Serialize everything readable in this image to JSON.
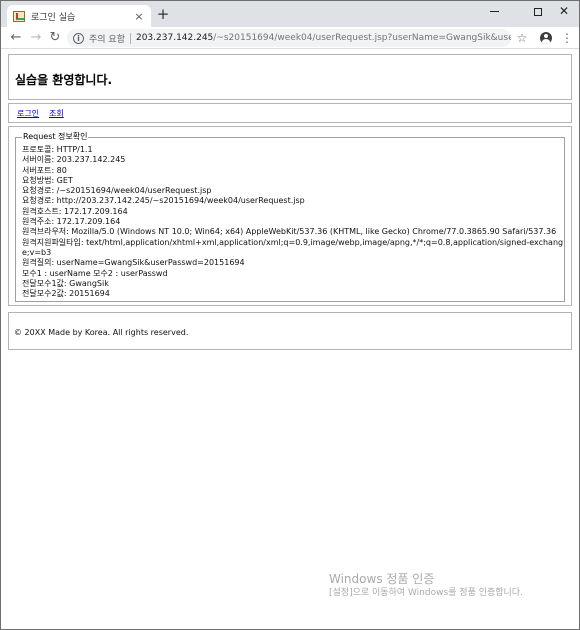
{
  "browser": {
    "tab_title": "로그인 실습",
    "tab_close": "×",
    "new_tab": "+",
    "security_label": "주의 요함",
    "url_host": "203.237.142.245",
    "url_rest": "/~s20151694/week04/userRequest.jsp?userName=GwangSik&userPasswd=2015..."
  },
  "page": {
    "title": "실습을 환영합니다.",
    "nav": [
      "로그인",
      "조회"
    ],
    "legend": "Request 정보확인",
    "info_lines": [
      "프로토콜: HTTP/1.1",
      "서버이름: 203.237.142.245",
      "서버포트: 80",
      "요청방법: GET",
      "요청경로: /~s20151694/week04/userRequest.jsp",
      "요청경로: http://203.237.142.245/~s20151694/week04/userRequest.jsp",
      "원격호스트: 172.17.209.164",
      "원격주소: 172.17.209.164",
      "원격브라우저: Mozilla/5.0 (Windows NT 10.0; Win64; x64) AppleWebKit/537.36 (KHTML, like Gecko) Chrome/77.0.3865.90 Safari/537.36",
      "원격지원파일타입: text/html,application/xhtml+xml,application/xml;q=0.9,image/webp,image/apng,*/*;q=0.8,application/signed-exchange;v=b3",
      "원격질의: userName=GwangSik&userPasswd=20151694",
      "모수1 : userName 모수2 : userPasswd",
      "전달모수1값: GwangSik",
      "전달모수2값: 20151694"
    ],
    "footer": "© 20XX Made by Korea. All rights reserved."
  },
  "watermark": {
    "title": "Windows 정품 인증",
    "message": "[설정]으로 이동하여 Windows를 정품 인증합니다."
  }
}
